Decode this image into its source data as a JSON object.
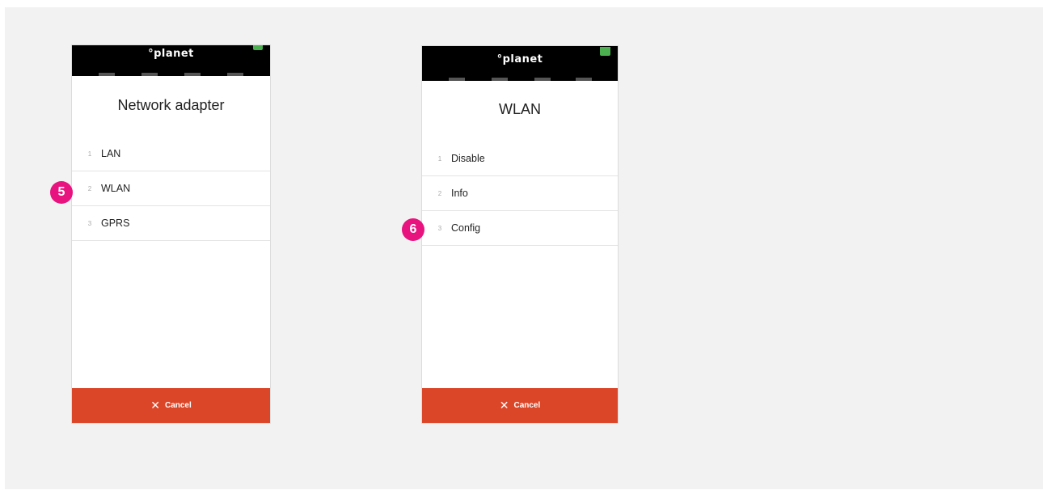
{
  "screens": [
    {
      "brand": "°planet",
      "title": "Network adapter",
      "items": [
        {
          "num": "1",
          "label": "LAN"
        },
        {
          "num": "2",
          "label": "WLAN"
        },
        {
          "num": "3",
          "label": "GPRS"
        }
      ],
      "cancel_label": "Cancel",
      "cancel_icon": "close-icon",
      "step_badge": "5"
    },
    {
      "brand": "°planet",
      "title": "WLAN",
      "items": [
        {
          "num": "1",
          "label": "Disable"
        },
        {
          "num": "2",
          "label": "Info"
        },
        {
          "num": "3",
          "label": "Config"
        }
      ],
      "cancel_label": "Cancel",
      "cancel_icon": "close-icon",
      "step_badge": "6"
    }
  ],
  "colors": {
    "cancel_bg": "#dc4628",
    "badge_bg": "#e8137f",
    "topbar_bg": "#000000",
    "battery": "#4caf50"
  }
}
